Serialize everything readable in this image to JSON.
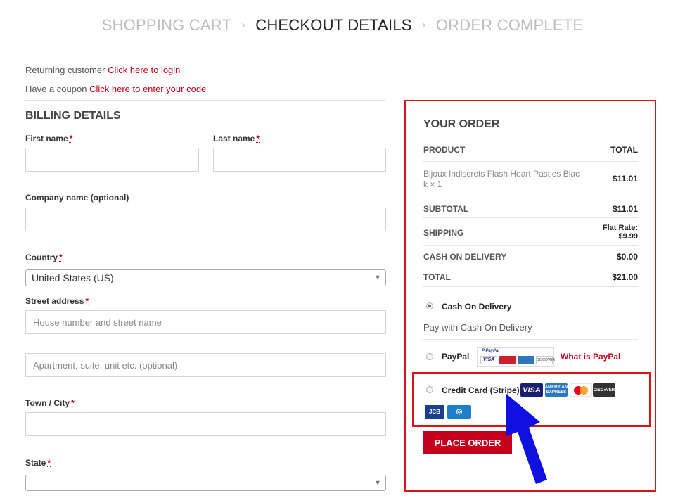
{
  "breadcrumb": {
    "step1": "SHOPPING CART",
    "step2": "CHECKOUT DETAILS",
    "step3": "ORDER COMPLETE",
    "separator": "›"
  },
  "notices": {
    "returning_text": "Returning customer",
    "login_link": "Click here to login",
    "coupon_text": "Have a coupon",
    "coupon_link": "Click here to enter your code"
  },
  "billing": {
    "title": "BILLING DETAILS",
    "required_mark": "*",
    "first_name_label": "First name",
    "last_name_label": "Last name",
    "company_label": "Company name (optional)",
    "country_label": "Country",
    "country_value": "United States (US)",
    "street_label": "Street address",
    "street_placeholder": "House number and street name",
    "apartment_placeholder": "Apartment, suite, unit etc. (optional)",
    "city_label": "Town / City",
    "state_label": "State"
  },
  "order": {
    "title": "YOUR ORDER",
    "col_product": "PRODUCT",
    "col_total": "TOTAL",
    "item_name": "Bijoux Indiscrets Flash Heart Pasties Black × 1",
    "item_name_line1": "Bijoux Indiscrets Flash Heart Pasties Blac",
    "item_name_line2": "k × 1",
    "item_price": "$11.01",
    "subtotal_label": "SUBTOTAL",
    "subtotal_value": "$11.01",
    "shipping_label": "SHIPPING",
    "shipping_value_line1": "Flat Rate:",
    "shipping_value_line2": "$9.99",
    "cod_label": "CASH ON DELIVERY",
    "cod_value": "$0.00",
    "total_label": "TOTAL",
    "total_value": "$21.00"
  },
  "payment": {
    "cod_label": "Cash On Delivery",
    "cod_desc": "Pay with Cash On Delivery",
    "paypal_label": "PayPal",
    "paypal_link": "What is PayPal",
    "stripe_label": "Credit Card (Stripe)",
    "place_order": "PLACE ORDER",
    "card_icons": [
      "visa",
      "amex",
      "mastercard",
      "discover",
      "jcb",
      "diners"
    ]
  },
  "colors": {
    "accent": "#c4001d",
    "highlight_border": "#e01010",
    "arrow": "#1010e0"
  }
}
